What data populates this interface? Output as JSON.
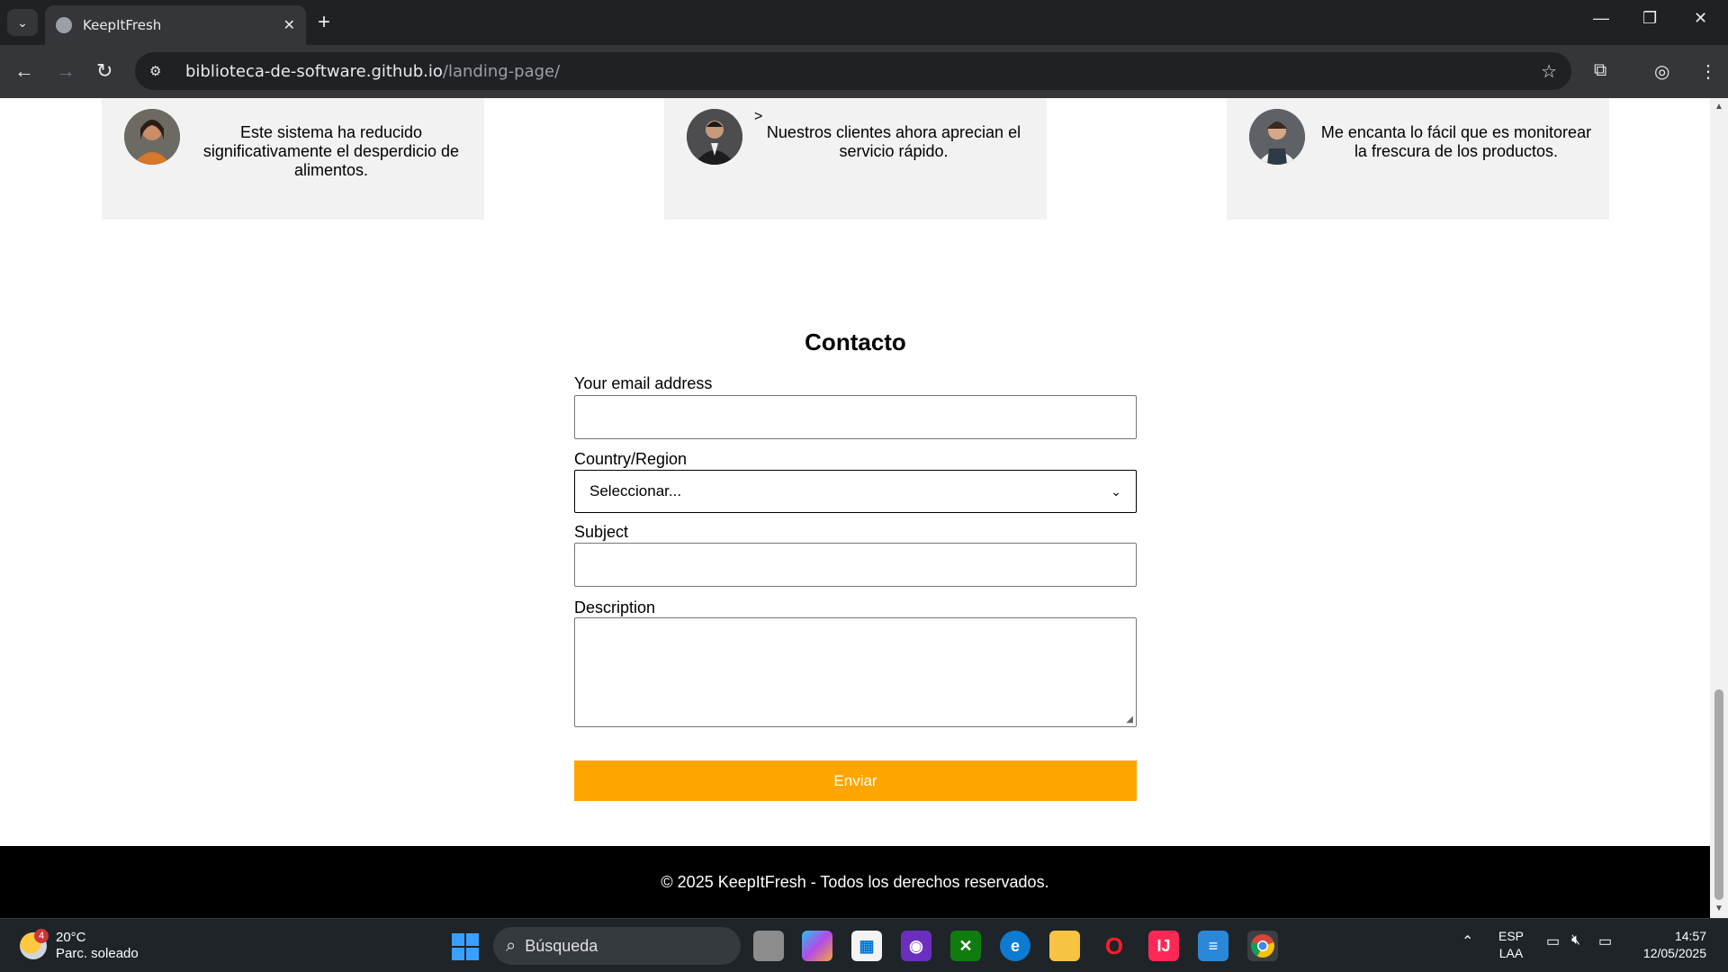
{
  "browser": {
    "tab_title": "KeepItFresh",
    "url_host": "biblioteca-de-software.github.io",
    "url_path": "/landing-page/"
  },
  "testimonials": [
    {
      "text": "Este sistema ha reducido significativamente el desperdicio de alimentos."
    },
    {
      "prefix": ">",
      "text": "Nuestros clientes ahora aprecian el servicio rápido."
    },
    {
      "text": "Me encanta lo fácil que es monitorear la frescura de los productos."
    }
  ],
  "contact": {
    "title": "Contacto",
    "email_label": "Your email address",
    "country_label": "Country/Region",
    "country_selected": "Seleccionar...",
    "subject_label": "Subject",
    "description_label": "Description",
    "submit_label": "Enviar"
  },
  "footer": {
    "text": "© 2025 KeepItFresh - Todos los derechos reservados."
  },
  "taskbar": {
    "weather_temp": "20°C",
    "weather_desc": "Parc. soleado",
    "weather_badge": "4",
    "search_placeholder": "Búsqueda",
    "lang_line1": "ESP",
    "lang_line2": "LAA",
    "time": "14:57",
    "date": "12/05/2025"
  },
  "colors": {
    "accent": "#ffa500",
    "footer_bg": "#000000",
    "card_bg": "#f2f2f2"
  }
}
